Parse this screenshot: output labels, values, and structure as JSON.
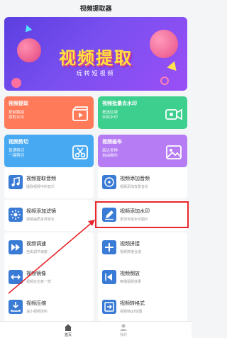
{
  "app": {
    "title": "视频提取器"
  },
  "banner": {
    "headline": "视频提取",
    "subline": "玩转短视频"
  },
  "features": [
    {
      "title": "视频提取",
      "desc1": "复制链接",
      "desc2": "提取水印",
      "icon": "film-play-icon",
      "color": "#ff7a59"
    },
    {
      "title": "视频批量去水印",
      "desc1": "框选区域",
      "desc2": "去除水印",
      "icon": "video-camera-icon",
      "color": "#3ccf8e"
    },
    {
      "title": "视频剪切",
      "desc1": "普通剪切",
      "desc2": "一键剪切",
      "icon": "scissors-clip-icon",
      "color": "#46a9f2"
    },
    {
      "title": "视频画布",
      "desc1": "高达多种",
      "desc2": "自由画布",
      "icon": "image-canvas-icon",
      "color": "#b57cf4"
    }
  ],
  "tools": [
    {
      "name": "视频提取音频",
      "desc": "提取视频中的音乐",
      "icon": "music-icon"
    },
    {
      "name": "视频添加音频",
      "desc": "视频添加背景音乐",
      "icon": "disc-icon"
    },
    {
      "name": "视频添加滤镜",
      "desc": "视频画质多样变化",
      "icon": "filter-icon"
    },
    {
      "name": "视频添加水印",
      "desc": "添加专属水印图片",
      "icon": "watermark-pen-icon"
    },
    {
      "name": "视频调速",
      "desc": "自由调节速度",
      "icon": "fast-forward-icon"
    },
    {
      "name": "视频拼接",
      "desc": "视频拼接合成",
      "icon": "plus-grid-icon"
    },
    {
      "name": "视频镜像",
      "desc": "视频左右变一样",
      "icon": "mirror-icon"
    },
    {
      "name": "视频倒放",
      "desc": "倒播视频效果",
      "icon": "reverse-play-icon"
    },
    {
      "name": "视频压缩",
      "desc": "减小视频体积",
      "icon": "compress-icon"
    },
    {
      "name": "视频转格式",
      "desc": "视频转gif动图",
      "icon": "convert-icon"
    }
  ],
  "nav": {
    "home_label": "首页",
    "mine_label": "我的"
  },
  "colors": {
    "accent": "#e8262b",
    "icon_blue": "#3a7bd5"
  }
}
